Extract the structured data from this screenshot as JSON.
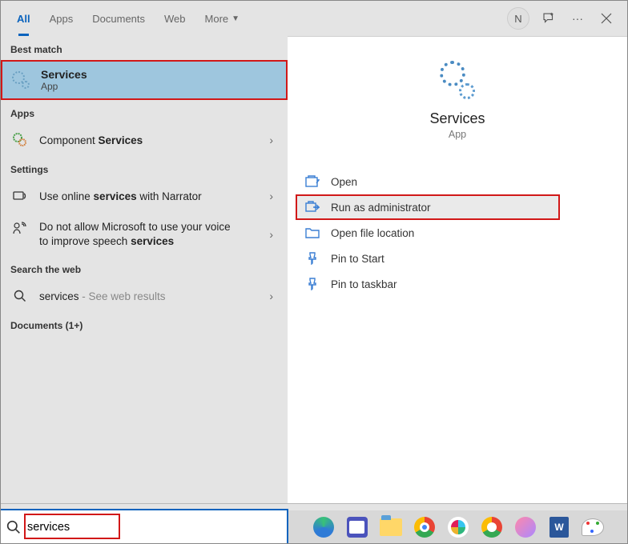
{
  "tabs": [
    "All",
    "Apps",
    "Documents",
    "Web",
    "More"
  ],
  "active_tab": 0,
  "user_initial": "N",
  "sections": {
    "best_match_label": "Best match",
    "apps_label": "Apps",
    "settings_label": "Settings",
    "search_web_label": "Search the web",
    "documents_label": "Documents (1+)"
  },
  "best_match": {
    "title": "Services",
    "subtitle": "App"
  },
  "apps_results": [
    {
      "prefix": "Component ",
      "bold": "Services"
    }
  ],
  "settings_results": [
    {
      "text_before": "Use online ",
      "bold": "services",
      "text_after": " with Narrator"
    },
    {
      "text_before": "Do not allow Microsoft to use your voice to improve speech ",
      "bold": "services",
      "text_after": ""
    }
  ],
  "web_results": [
    {
      "term": "services",
      "suffix": " - See web results"
    }
  ],
  "detail": {
    "title": "Services",
    "subtitle": "App"
  },
  "actions": {
    "open": "Open",
    "run_admin": "Run as administrator",
    "open_location": "Open file location",
    "pin_start": "Pin to Start",
    "pin_taskbar": "Pin to taskbar"
  },
  "search_query": "services"
}
